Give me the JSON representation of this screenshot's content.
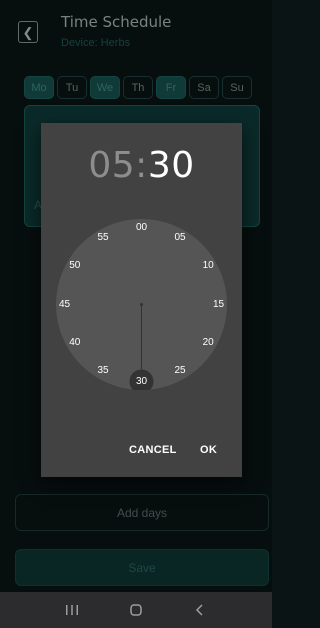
{
  "header": {
    "title": "Time Schedule",
    "subtitle": "Device: Herbs"
  },
  "days": [
    {
      "label": "Mo",
      "selected": true
    },
    {
      "label": "Tu",
      "selected": false
    },
    {
      "label": "We",
      "selected": true
    },
    {
      "label": "Th",
      "selected": false
    },
    {
      "label": "Fr",
      "selected": true
    },
    {
      "label": "Sa",
      "selected": false
    },
    {
      "label": "Su",
      "selected": false
    }
  ],
  "background_card": {
    "partial_label": "A"
  },
  "add_days_label": "Add days",
  "save_label": "Save",
  "dialog": {
    "hour": "05",
    "separator": ":",
    "minute": "30",
    "clock_numbers": [
      "00",
      "05",
      "10",
      "15",
      "20",
      "25",
      "30",
      "35",
      "40",
      "45",
      "50",
      "55"
    ],
    "selected_minute": "30",
    "cancel_label": "CANCEL",
    "ok_label": "OK"
  },
  "navbar": {
    "recents_icon": "recents-icon",
    "home_icon": "home-icon",
    "back_icon": "back-icon"
  },
  "colors": {
    "accent": "#15514d",
    "dialog_bg": "#424242",
    "clock_face": "#555555",
    "selection": "#333333"
  }
}
